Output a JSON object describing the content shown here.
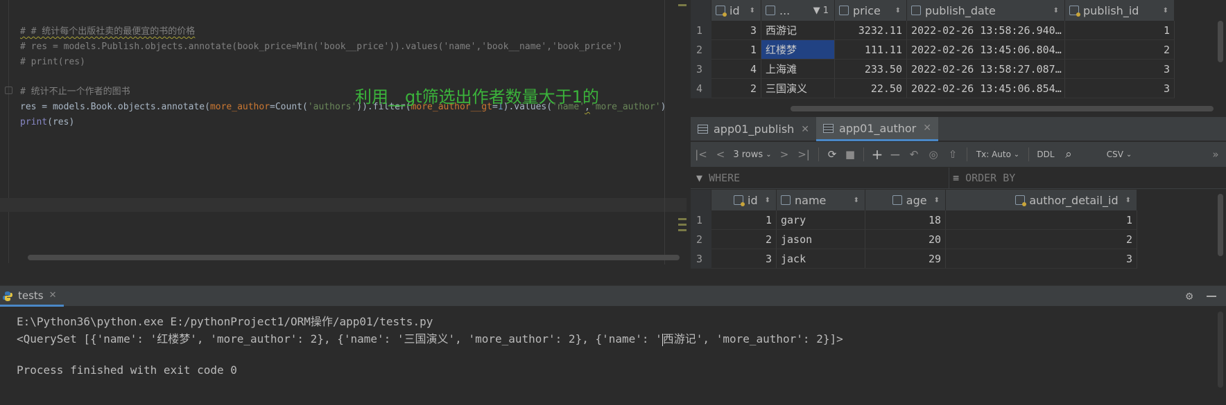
{
  "editor": {
    "lines": [
      {
        "kind": "comment-cn",
        "text": "# # 统计每个出版社卖的最便宜的书的价格"
      },
      {
        "kind": "comment",
        "text": "# res = models.Publish.objects.annotate(book_price=Min('book__price')).values('name','book__name','book_price')"
      },
      {
        "kind": "comment",
        "text": "# print(res)"
      },
      {
        "kind": "blank",
        "text": ""
      },
      {
        "kind": "comment-cn",
        "text": "# 统计不止一个作者的图书"
      },
      {
        "kind": "code",
        "text": "res = models.Book.objects.annotate(more_author=Count('authors')).filter(more_author__gt=1).values('name','more_author')"
      },
      {
        "kind": "code2",
        "text": "print(res)"
      }
    ],
    "annotation": "利用__gt筛选出作者数量大于1的"
  },
  "book_grid": {
    "columns": [
      {
        "label": "id",
        "icon": "key-column-icon"
      },
      {
        "label": "...",
        "icon": "column-icon",
        "sort": "▼ 1"
      },
      {
        "label": "price",
        "icon": "column-icon"
      },
      {
        "label": "publish_date",
        "icon": "column-icon"
      },
      {
        "label": "publish_id",
        "icon": "foreign-key-column-icon"
      }
    ],
    "rows": [
      {
        "n": "1",
        "id": "3",
        "name": "西游记",
        "price": "3232.11",
        "date": "2022-02-26 13:58:26.940…",
        "publish_id": "1"
      },
      {
        "n": "2",
        "id": "1",
        "name": "红楼梦",
        "price": "111.11",
        "date": "2022-02-26 13:45:06.804…",
        "publish_id": "2"
      },
      {
        "n": "3",
        "id": "4",
        "name": "上海滩",
        "price": "233.50",
        "date": "2022-02-26 13:58:27.087…",
        "publish_id": "3"
      },
      {
        "n": "4",
        "id": "2",
        "name": "三国演义",
        "price": "22.50",
        "date": "2022-02-26 13:45:06.854…",
        "publish_id": "3"
      }
    ]
  },
  "tabs": [
    {
      "label": "app01_publish",
      "active": false
    },
    {
      "label": "app01_author",
      "active": true
    }
  ],
  "toolbar": {
    "rows_label": "3 rows",
    "tx_label": "Tx: Auto",
    "ddl_label": "DDL",
    "csv_label": "CSV"
  },
  "filter": {
    "where": "WHERE",
    "order_by": "ORDER BY"
  },
  "author_grid": {
    "columns": [
      {
        "label": "id",
        "icon": "key-column-icon"
      },
      {
        "label": "name",
        "icon": "column-icon"
      },
      {
        "label": "age",
        "icon": "column-icon"
      },
      {
        "label": "author_detail_id",
        "icon": "foreign-key-column-icon"
      }
    ],
    "rows": [
      {
        "n": "1",
        "id": "1",
        "name": "gary",
        "age": "18",
        "detail": "1"
      },
      {
        "n": "2",
        "id": "2",
        "name": "jason",
        "age": "20",
        "detail": "2"
      },
      {
        "n": "3",
        "id": "3",
        "name": "jack",
        "age": "29",
        "detail": "3"
      }
    ]
  },
  "run": {
    "tab_label": "tests",
    "cmd": "E:\\Python36\\python.exe E:/pythonProject1/ORM操作/app01/tests.py",
    "output_a": "<QuerySet [{'name': '红楼梦', 'more_author': 2}, {'name': '三国演义', 'more_author': 2}, {'name': '",
    "output_b": "西游记', 'more_author': 2}]>",
    "exit": "Process finished with exit code 0"
  }
}
